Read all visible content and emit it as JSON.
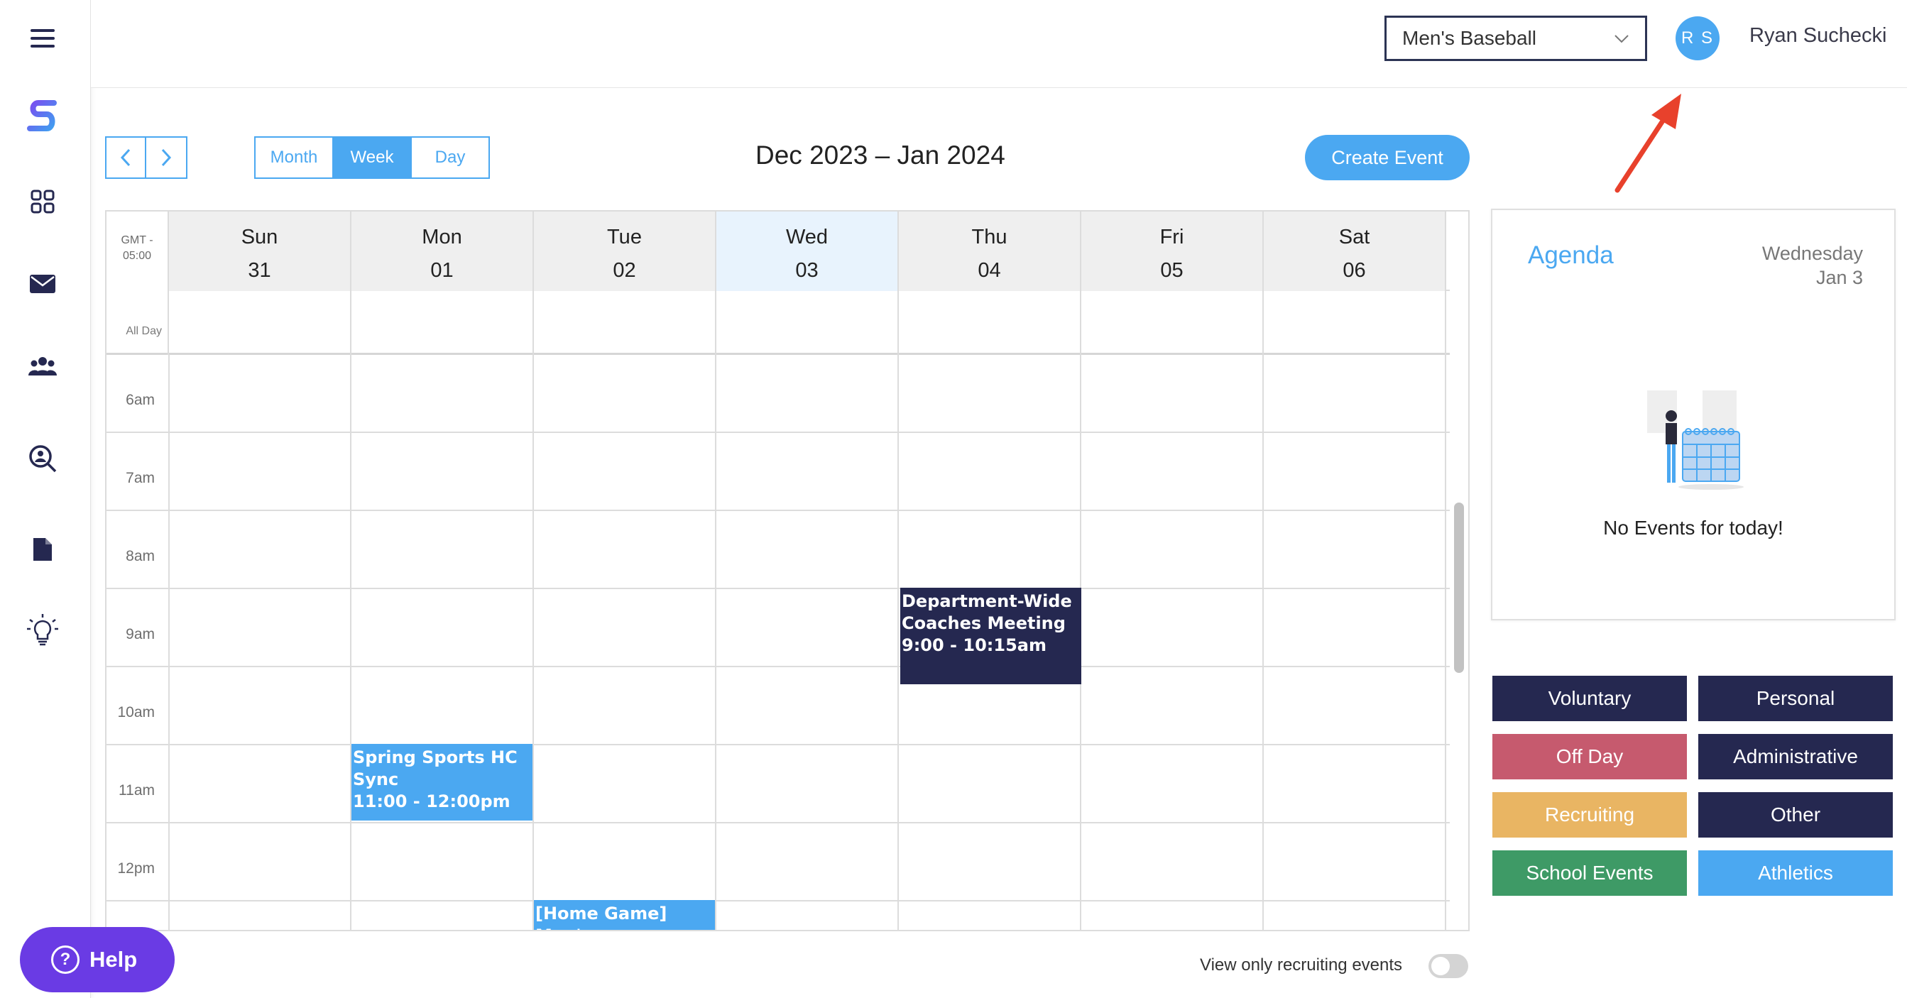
{
  "sidebar": {
    "items": [
      {
        "icon": "hamburger-menu-icon"
      },
      {
        "icon": "app-logo-icon"
      },
      {
        "icon": "dashboard-grid-icon"
      },
      {
        "icon": "mail-icon"
      },
      {
        "icon": "team-people-icon"
      },
      {
        "icon": "search-person-icon"
      },
      {
        "icon": "document-icon"
      },
      {
        "icon": "lightbulb-icon"
      }
    ]
  },
  "header": {
    "team_select_value": "Men's Baseball",
    "avatar_initials": "R S",
    "user_name": "Ryan Suchecki"
  },
  "toolbar": {
    "views": [
      "Month",
      "Week",
      "Day"
    ],
    "active_view": "Week",
    "range_title": "Dec 2023 – Jan 2024",
    "create_label": "Create Event"
  },
  "calendar": {
    "timezone": "GMT - 05:00",
    "all_day_label": "All Day",
    "days": [
      {
        "name": "Sun",
        "num": "31"
      },
      {
        "name": "Mon",
        "num": "01"
      },
      {
        "name": "Tue",
        "num": "02"
      },
      {
        "name": "Wed",
        "num": "03"
      },
      {
        "name": "Thu",
        "num": "04"
      },
      {
        "name": "Fri",
        "num": "05"
      },
      {
        "name": "Sat",
        "num": "06"
      }
    ],
    "today_index": 3,
    "hours": [
      "6am",
      "7am",
      "8am",
      "9am",
      "10am",
      "11am",
      "12pm"
    ],
    "events": [
      {
        "title": "Department-Wide Coaches Meeting",
        "time": "9:00 - 10:15am",
        "day": "Thu",
        "color": "#252850"
      },
      {
        "title": "Spring Sports HC Sync",
        "time": "11:00 - 12:00pm",
        "day": "Mon",
        "color": "#4ba8f1"
      },
      {
        "title": "[Home Game] Men's",
        "time": "",
        "day": "Tue",
        "color": "#4ba8f1"
      }
    ]
  },
  "footer": {
    "help_label": "Help",
    "recruiting_toggle_label": "View only recruiting events",
    "recruiting_toggle_on": false
  },
  "agenda": {
    "title": "Agenda",
    "weekday": "Wednesday",
    "date": "Jan 3",
    "empty_text": "No Events for today!"
  },
  "categories": [
    {
      "label": "Voluntary",
      "color": "#252850"
    },
    {
      "label": "Personal",
      "color": "#252850"
    },
    {
      "label": "Off Day",
      "color": "#c65a6e"
    },
    {
      "label": "Administrative",
      "color": "#252850"
    },
    {
      "label": "Recruiting",
      "color": "#e9b563"
    },
    {
      "label": "Other",
      "color": "#252850"
    },
    {
      "label": "School Events",
      "color": "#3e9a66"
    },
    {
      "label": "Athletics",
      "color": "#4ba8f1"
    }
  ],
  "colors": {
    "accent": "#4ba8f1",
    "navy": "#252850",
    "help_purple": "#6a3be4",
    "annotation_red": "#e8412c"
  }
}
